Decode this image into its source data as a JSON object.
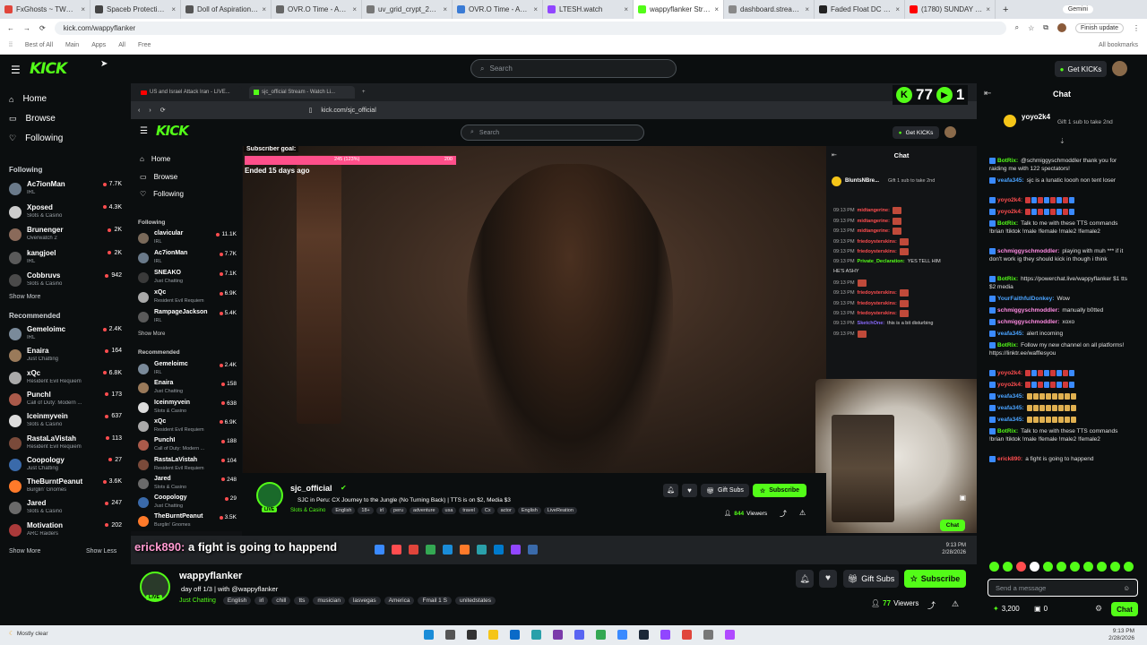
{
  "browser": {
    "tabs": [
      {
        "label": "FxGhosts ~ TWC L...",
        "color": "#e0453b"
      },
      {
        "label": "Spaceb Protection Quiz ~",
        "color": "#444"
      },
      {
        "label": "Doll of Aspiration Fu...",
        "color": "#555"
      },
      {
        "label": "OVR.O Time - Aquarium...",
        "color": "#666"
      },
      {
        "label": "uv_grid_crypt_2DEE3...",
        "color": "#777"
      },
      {
        "label": "OVR.O Time - Aquarium...",
        "color": "#3a7bd5"
      },
      {
        "label": "LTESH.watch",
        "color": "#9146ff"
      },
      {
        "label": "wappyflanker Stream",
        "color": "#53fc18"
      },
      {
        "label": "dashboard.stream.com",
        "color": "#888"
      },
      {
        "label": "Faded Float DC Subsc...",
        "color": "#222"
      },
      {
        "label": "(1780) SUNDAY CH...",
        "color": "#ff0000"
      }
    ],
    "new_tab": "+",
    "url": "kick.com/wappyflanker",
    "bookmarks": [
      "Best of All",
      "Main",
      "Apps",
      "All",
      "Free"
    ],
    "profile_label": "Gemini",
    "finish_update": "Finish update",
    "all_bookmarks": "All bookmarks"
  },
  "header": {
    "logo": "KICK",
    "search_placeholder": "Search",
    "get_kicks": "Get KICKs"
  },
  "sidebar": {
    "nav": [
      "Home",
      "Browse",
      "Following"
    ],
    "following_title": "Following",
    "following": [
      {
        "name": "Ac7ionMan",
        "cat": "IRL",
        "viewers": "7.7K",
        "color": "#6a7a8a"
      },
      {
        "name": "Xposed",
        "cat": "Slots & Casino",
        "viewers": "4.3K",
        "color": "#cccccc"
      },
      {
        "name": "Brunenger",
        "cat": "Overwatch 2",
        "viewers": "2K",
        "color": "#8a6a5a"
      },
      {
        "name": "kangjoel",
        "cat": "IRL",
        "viewers": "2K",
        "color": "#5a5a5a"
      },
      {
        "name": "Cobbruvs",
        "cat": "Slots & Casino",
        "viewers": "942",
        "color": "#4a4a4a"
      }
    ],
    "show_more": "Show More",
    "recommended_title": "Recommended",
    "recommended": [
      {
        "name": "Gemeloimc",
        "cat": "IRL",
        "viewers": "2.4K",
        "color": "#7a8a9a"
      },
      {
        "name": "Enaira",
        "cat": "Just Chatting",
        "viewers": "164",
        "color": "#9a7a5a"
      },
      {
        "name": "xQc",
        "cat": "Resident Evil Requiem",
        "viewers": "6.8K",
        "color": "#aaaaaa"
      },
      {
        "name": "PunchI",
        "cat": "Call of Duty: Modern ...",
        "viewers": "173",
        "color": "#aa5a4a"
      },
      {
        "name": "Iceinmyvein",
        "cat": "Slots & Casino",
        "viewers": "637",
        "color": "#dddddd"
      },
      {
        "name": "RastaLaVistah",
        "cat": "Resident Evil Requiem",
        "viewers": "113",
        "color": "#7a4a3a"
      },
      {
        "name": "Coopology",
        "cat": "Just Chatting",
        "viewers": "27",
        "color": "#3a6aaa"
      },
      {
        "name": "TheBurntPeanut",
        "cat": "Burglin' Gnomes",
        "viewers": "3.6K",
        "color": "#ff7a2a"
      },
      {
        "name": "Jared",
        "cat": "Slots & Casino",
        "viewers": "247",
        "color": "#6a6a6a"
      },
      {
        "name": "Motivation",
        "cat": "ARC Raiders",
        "viewers": "202",
        "color": "#aa3a3a"
      }
    ],
    "show_more2": "Show More",
    "show_less": "Show Less"
  },
  "inner": {
    "tabs": [
      "US and Israel Attack Iran - LIVE...",
      "sjc_official Stream - Watch Li..."
    ],
    "url": "kick.com/sjc_official",
    "logo": "KICK",
    "search_placeholder": "Search",
    "get_kicks": "Get KICKs",
    "overlay_number": "77",
    "overlay_number2": "1",
    "nav": [
      "Home",
      "Browse",
      "Following"
    ],
    "following_title": "Following",
    "following": [
      {
        "name": "clavicular",
        "cat": "IRL",
        "viewers": "11.1K",
        "color": "#7a6a5a"
      },
      {
        "name": "Ac7ionMan",
        "cat": "IRL",
        "viewers": "7.7K",
        "color": "#6a7a8a"
      },
      {
        "name": "SNEAKO",
        "cat": "Just Chatting",
        "viewers": "7.1K",
        "color": "#3a3a3a"
      },
      {
        "name": "xQc",
        "cat": "Resident Evil Requiem",
        "viewers": "6.9K",
        "color": "#aaaaaa"
      },
      {
        "name": "RampageJackson",
        "cat": "IRL",
        "viewers": "5.4K",
        "color": "#5a5a5a"
      }
    ],
    "show_more": "Show More",
    "recommended_title": "Recommended",
    "recommended": [
      {
        "name": "Gemeloimc",
        "cat": "IRL",
        "viewers": "2.4K",
        "color": "#7a8a9a"
      },
      {
        "name": "Enaira",
        "cat": "Just Chatting",
        "viewers": "158",
        "color": "#9a7a5a"
      },
      {
        "name": "Iceinmyvein",
        "cat": "Slots & Casino",
        "viewers": "638",
        "color": "#dddddd"
      },
      {
        "name": "xQc",
        "cat": "Resident Evil Requiem",
        "viewers": "6.9K",
        "color": "#aaaaaa"
      },
      {
        "name": "PunchI",
        "cat": "Call of Duty: Modern ...",
        "viewers": "188",
        "color": "#aa5a4a"
      },
      {
        "name": "RastaLaVistah",
        "cat": "Resident Evil Requiem",
        "viewers": "104",
        "color": "#7a4a3a"
      },
      {
        "name": "Jared",
        "cat": "Slots & Casino",
        "viewers": "248",
        "color": "#6a6a6a"
      },
      {
        "name": "Coopology",
        "cat": "Just Chatting",
        "viewers": "29",
        "color": "#3a6aaa"
      },
      {
        "name": "TheBurntPeanut",
        "cat": "Burglin' Gnomes",
        "viewers": "3.5K",
        "color": "#ff7a2a"
      }
    ],
    "sub_goal_label": "Subscriber goal:",
    "sub_goal_progress": "245 (123%)",
    "sub_goal_target": "200",
    "sub_goal_pct": 100,
    "sub_goal_ended": "Ended 15 days ago",
    "chat_title": "Chat",
    "chat_top_user": "BluntsNBre...",
    "chat_top_gift": "Gift 1 sub to take 2nd",
    "chat_messages": [
      {
        "time": "09:13 PM",
        "user": "midtangerine:",
        "text": "",
        "color": "#ff4d4f"
      },
      {
        "time": "09:13 PM",
        "user": "midtangerine:",
        "text": "",
        "color": "#ff4d4f"
      },
      {
        "time": "09:13 PM",
        "user": "midtangerine:",
        "text": "",
        "color": "#ff4d4f"
      },
      {
        "time": "09:13 PM",
        "user": "friedoysterskins:",
        "text": "",
        "color": "#ff4d4f"
      },
      {
        "time": "09:13 PM",
        "user": "friedoysterskins:",
        "text": "",
        "color": "#ff4d4f"
      },
      {
        "time": "09:13 PM",
        "user": "Private_Declaration:",
        "text": "YES TELL HIM",
        "color": "#53fc18"
      },
      {
        "time": "",
        "user": "",
        "text": "HE'S ASHY",
        "color": "#ffffff"
      },
      {
        "time": "09:13 PM",
        "user": "",
        "text": "",
        "color": "#ff4d4f"
      },
      {
        "time": "09:13 PM",
        "user": "friedoysterskins:",
        "text": "",
        "color": "#ff4d4f"
      },
      {
        "time": "09:13 PM",
        "user": "friedoysterskins:",
        "text": "",
        "color": "#ff4d4f"
      },
      {
        "time": "09:13 PM",
        "user": "friedoysterskins:",
        "text": "",
        "color": "#ff4d4f"
      },
      {
        "time": "09:13 PM",
        "user": "SketchOne:",
        "text": "this is a bit disturbing",
        "color": "#8a6aff"
      },
      {
        "time": "09:13 PM",
        "user": "",
        "text": "",
        "color": "#ff4d4f"
      }
    ],
    "channel_name": "sjc_official",
    "title": "SJC in Peru: CX Journey to the Jungle (No Turning Back) | TTS is on $2, Media $3",
    "category": "Slots & Casino",
    "tags": [
      "English",
      "18+",
      "irl",
      "peru",
      "adventure",
      "usa",
      "travel",
      "Cx",
      "actor",
      "English",
      "LiveReation"
    ],
    "gift_subs": "Gift Subs",
    "subscribe": "Subscribe",
    "viewers": "844",
    "viewers_label": "Viewers",
    "chat_button": "Chat",
    "clock_time": "9:13 PM",
    "clock_date": "2/28/2026",
    "caption_user": "erick890:",
    "caption_text": "a fight is going to happend"
  },
  "right_chat": {
    "title": "Chat",
    "pinned_user": "yoyo2k4",
    "pinned_gift": "Gift 1 sub to take 2nd",
    "messages": [
      {
        "user": "BotRix:",
        "text": "@schmiggyschmoddler thank you for raiding me with 122 spectators!",
        "color": "#53fc18"
      },
      {
        "user": "veafa345:",
        "text": "sjc is a lunatic loooh non tent loser",
        "color": "#4aa3ff"
      },
      {
        "user": "yoyo2k4:",
        "text": "",
        "color": "#ff4d4f"
      },
      {
        "user": "yoyo2k4:",
        "text": "",
        "color": "#ff4d4f"
      },
      {
        "user": "BotRix:",
        "text": "Talk to me with these TTS commands !brian !tiktok !male !female !male2 !female2",
        "color": "#53fc18"
      },
      {
        "user": "schmiggyschmoddler:",
        "text": "playing with muh *** if it don't work ig they should kick in though i think",
        "color": "#ff8ae2"
      },
      {
        "user": "BotRix:",
        "text": "https://powerchat.live/wappyflanker $1 tts $2 media",
        "color": "#53fc18"
      },
      {
        "user": "YourFaithfulDonkey:",
        "text": "Wow",
        "color": "#4aa3ff"
      },
      {
        "user": "schmiggyschmoddler:",
        "text": "manually b0tted",
        "color": "#ff8ae2"
      },
      {
        "user": "schmiggyschmoddler:",
        "text": "xoxo",
        "color": "#ff8ae2"
      },
      {
        "user": "veafa345:",
        "text": "alert incoming",
        "color": "#4aa3ff"
      },
      {
        "user": "BotRix:",
        "text": "Follow my new channel on all platforms! https://linktr.ee/wafflesyou",
        "color": "#53fc18"
      },
      {
        "user": "yoyo2k4:",
        "text": "",
        "color": "#ff4d4f"
      },
      {
        "user": "yoyo2k4:",
        "text": "",
        "color": "#ff4d4f"
      },
      {
        "user": "veafa345:",
        "text": "",
        "color": "#4aa3ff"
      },
      {
        "user": "veafa345:",
        "text": "",
        "color": "#4aa3ff"
      },
      {
        "user": "veafa345:",
        "text": "",
        "color": "#4aa3ff"
      },
      {
        "user": "BotRix:",
        "text": "Talk to me with these TTS commands !brian !tiktok !male !female !male2 !female2",
        "color": "#53fc18"
      },
      {
        "user": "erick890:",
        "text": "a fight is going to happend",
        "color": "#ff4d4f"
      }
    ],
    "input_placeholder": "Send a message",
    "points": "3,200",
    "count": "0",
    "chat_button": "Chat"
  },
  "channel": {
    "name": "wappyflanker",
    "title": "day off 1/3 | with @wappyflanker",
    "category": "Just Chatting",
    "tags": [
      "English",
      "irl",
      "chill",
      "tts",
      "musician",
      "lasvegas",
      "America",
      "Fmail 1 S",
      "unitedstates"
    ],
    "gift_subs": "Gift Subs",
    "subscribe": "Subscribe",
    "viewers": "77",
    "viewers_label": "Viewers"
  },
  "taskbar": {
    "weather": "Mostly clear",
    "time": "9:13 PM",
    "date": "2/28/2026"
  }
}
